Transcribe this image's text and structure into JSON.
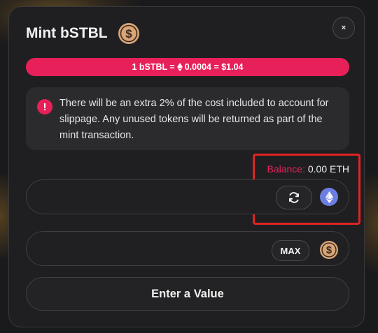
{
  "modal": {
    "title": "Mint bSTBL",
    "close_label": "×"
  },
  "rate": {
    "prefix": "1 bSTBL =",
    "eth_amount": "0.0004",
    "usd_part": "= $1.04"
  },
  "notice": {
    "icon": "exclamation-icon",
    "text": "There will be an extra 2% of the cost included to account for slippage. Any unused tokens will be returned as part of the mint transaction."
  },
  "input_eth": {
    "balance_label": "Balance:",
    "balance_value": "0.00 ETH",
    "value": "",
    "swap_icon": "swap-refresh-icon",
    "token_icon": "ethereum-icon"
  },
  "output_bstbl": {
    "value": "",
    "max_label": "MAX",
    "token_icon": "dollar-coin-icon"
  },
  "submit": {
    "label": "Enter a Value"
  },
  "colors": {
    "accent": "#e8205a",
    "highlight": "#e02323",
    "eth": "#6c7fe0",
    "coin": "#d9a577"
  }
}
